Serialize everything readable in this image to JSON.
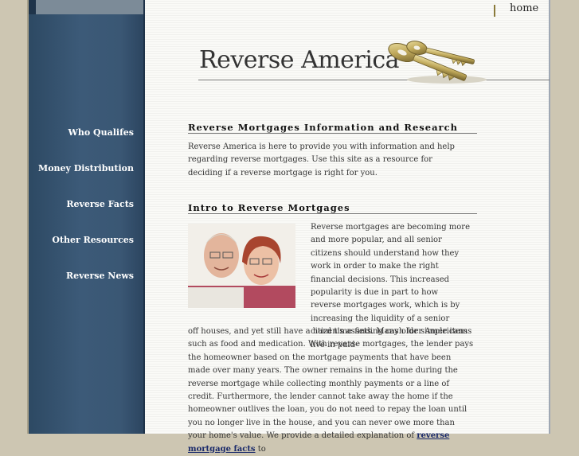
{
  "header": {
    "title": "Reverse America",
    "home_link": "home"
  },
  "sidebar": {
    "items": [
      {
        "label": "Who Qualifes"
      },
      {
        "label": "Money Distribution"
      },
      {
        "label": "Reverse Facts"
      },
      {
        "label": "Other Resources"
      },
      {
        "label": "Reverse News"
      }
    ]
  },
  "sections": {
    "info": {
      "heading": "Reverse Mortgages Information and Research",
      "text": "Reverse America is here to provide you with information and help regarding reverse mortgages. Use this site as a resource for deciding if a reverse mortgage is right for you."
    },
    "intro": {
      "heading": "Intro to Reverse Mortgages",
      "text_right": "Reverse mortgages are becoming more and more popular, and all senior citizens should understand how they work in order to make the right financial decisions. This increased popularity is due in part to how reverse mortgages work, which is by increasing the liquidity of a senior citizen's assets. Many older Americans live in paid-",
      "text_bottom": "off houses, and yet still have a hard time finding cash for simple items such as food and medication. With reverse mortgages, the lender pays the homeowner based on the mortgage payments that have been made over many years. The owner remains in the home during the reverse mortgage while collecting monthly payments or a line of credit. Furthermore, the lender cannot take away the home if the homeowner outlives the loan, you do not need to repay the loan until you no longer live in the house, and you can never owe more than your home's value. We provide a detailed explanation of",
      "link_text": "reverse mortgage facts",
      "text_after_link": "to"
    }
  },
  "colors": {
    "sidebar": "#3a5774",
    "page_bg": "#cdc6b2",
    "content_bg": "#fafaf7",
    "link": "#1a2a6a"
  },
  "icons": [
    "keys-image",
    "senior-couple-photo"
  ]
}
